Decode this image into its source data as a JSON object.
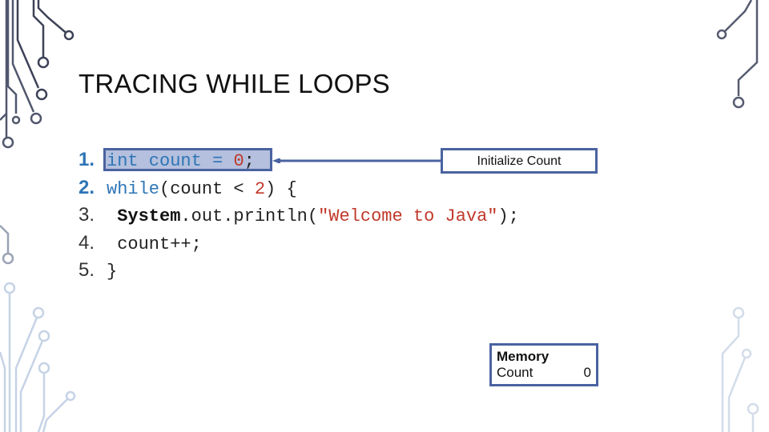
{
  "slide": {
    "title": "TRACING WHILE LOOPS"
  },
  "code": {
    "lines": [
      {
        "number": "1.",
        "parts": [
          {
            "text": "int",
            "style": "kw"
          },
          {
            "text": " count = ",
            "style": "kw"
          },
          {
            "text": "0",
            "style": "lit"
          },
          {
            "text": ";",
            "style": "plain"
          }
        ]
      },
      {
        "number": "2.",
        "parts": [
          {
            "text": "while",
            "style": "kw"
          },
          {
            "text": "(count < ",
            "style": "plain"
          },
          {
            "text": "2",
            "style": "lit"
          },
          {
            "text": ") {",
            "style": "plain"
          }
        ]
      },
      {
        "number": "3.",
        "parts": [
          {
            "text": " ",
            "style": "plain"
          },
          {
            "text": "System",
            "style": "bold"
          },
          {
            "text": ".out.println(",
            "style": "plain"
          },
          {
            "text": "\"Welcome to Java\"",
            "style": "str"
          },
          {
            "text": ");",
            "style": "plain"
          }
        ]
      },
      {
        "number": "4.",
        "parts": [
          {
            "text": " count++;",
            "style": "plain"
          }
        ]
      },
      {
        "number": "5.",
        "parts": [
          {
            "text": "}",
            "style": "plain"
          }
        ]
      }
    ],
    "highlighted_line": 1
  },
  "callout": {
    "label": "Initialize Count"
  },
  "memory": {
    "title": "Memory",
    "variables": [
      {
        "name": "Count",
        "value": "0"
      }
    ]
  },
  "colors": {
    "accent": "#4a63a0",
    "highlight_fill": "#b4c0dd",
    "keyword": "#2e75b6",
    "literal": "#c0392b"
  }
}
